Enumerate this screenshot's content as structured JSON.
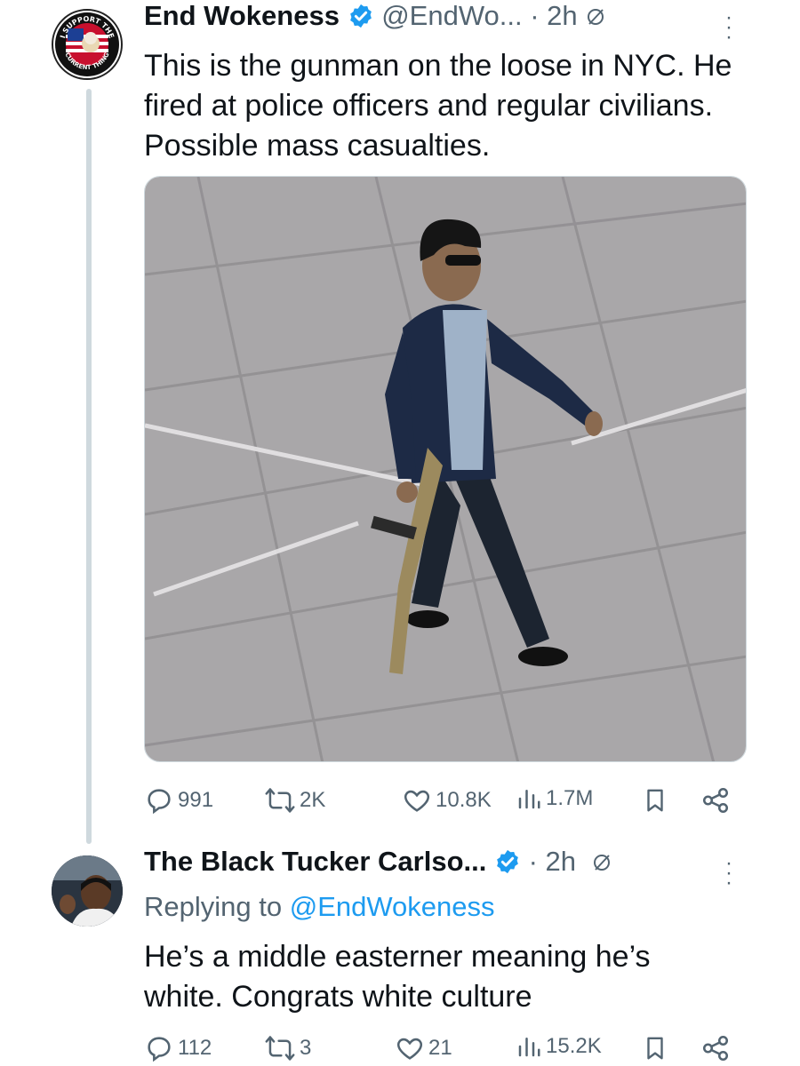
{
  "colors": {
    "accent": "#1d9bf0",
    "muted": "#536471",
    "text": "#0f1419",
    "line": "#cfd9de"
  },
  "tweet1": {
    "avatar_text_top": "I SUPPORT THE",
    "avatar_text_bottom": "CURRENT THING",
    "name": "End Wokeness",
    "handle": "@EndWo...",
    "time": "· 2h",
    "text": "This is the gunman on the loose in NYC. He fired at police officers and regular civilians. Possible mass casualties.",
    "image_icon": "photo-of-man-walking-with-rifle",
    "stats": {
      "replies": "991",
      "reposts": "2K",
      "likes": "10.8K",
      "views": "1.7M"
    }
  },
  "tweet2": {
    "name": "The Black Tucker Carlso...",
    "time": "· 2h",
    "replying_prefix": "Replying to",
    "replying_handle": "@EndWokeness",
    "text": "He’s a middle easterner meaning he’s white. Congrats white culture",
    "stats": {
      "replies": "112",
      "reposts": "3",
      "likes": "21",
      "views": "15.2K"
    }
  }
}
